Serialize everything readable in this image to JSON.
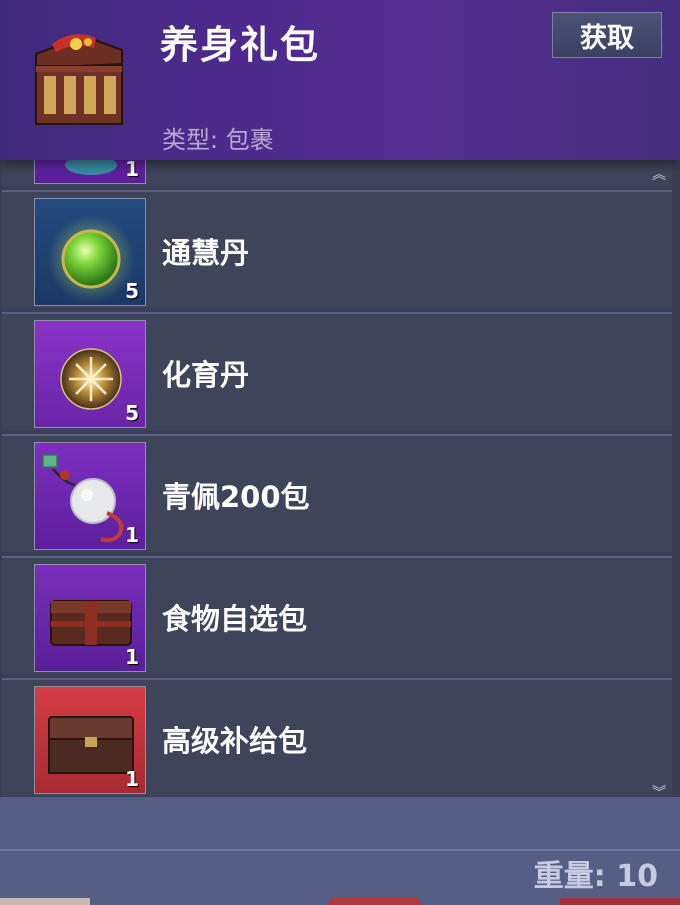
{
  "header": {
    "title": "养身礼包",
    "type_label": "类型: 包裹",
    "obtain_label": "获取",
    "icon": "treasure-chest-icon"
  },
  "items": [
    {
      "name": "",
      "count": "1",
      "icon": "partial-item-icon"
    },
    {
      "name": "通慧丹",
      "count": "5",
      "icon": "green-orb-icon"
    },
    {
      "name": "化育丹",
      "count": "5",
      "icon": "golden-star-orb-icon"
    },
    {
      "name": "青佩200包",
      "count": "1",
      "icon": "jade-pendant-icon"
    },
    {
      "name": "食物自选包",
      "count": "1",
      "icon": "food-box-icon"
    },
    {
      "name": "高级补给包",
      "count": "1",
      "icon": "supply-chest-icon"
    }
  ],
  "footer": {
    "weight_label": "重量: 10"
  },
  "colors": {
    "header_purple": "#552d90",
    "row_bg": "#3e4459",
    "footer_bg": "#555e85"
  }
}
